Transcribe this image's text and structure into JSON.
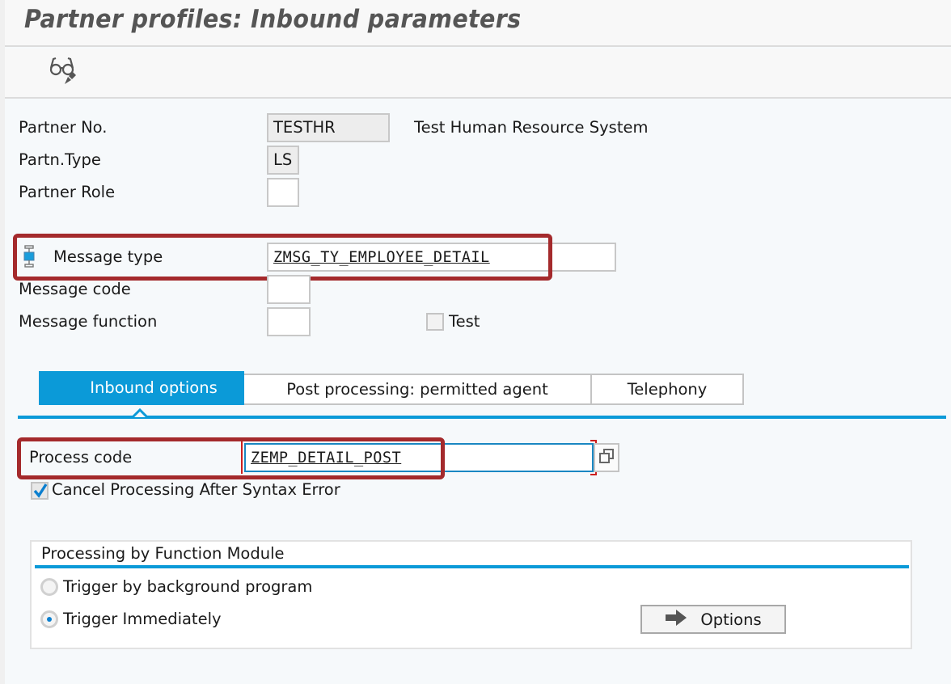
{
  "title": "Partner profiles: Inbound parameters",
  "toolbar": {
    "display_change_icon": "glasses-pencil-icon"
  },
  "header_fields": {
    "partner_no": {
      "label": "Partner No.",
      "value": "TESTHR",
      "description": "Test Human Resource System"
    },
    "partner_type": {
      "label": "Partn.Type",
      "value": "LS"
    },
    "partner_role": {
      "label": "Partner Role",
      "value": ""
    },
    "message_type": {
      "label": "Message type",
      "value": "ZMSG_TY_EMPLOYEE_DETAIL",
      "icon": "hierarchy-node-icon"
    },
    "message_code": {
      "label": "Message code",
      "value": ""
    },
    "message_function": {
      "label": "Message function",
      "value": ""
    },
    "test": {
      "label": "Test",
      "checked": false
    }
  },
  "tabs": [
    {
      "label": "Inbound options",
      "active": true
    },
    {
      "label": "Post processing: permitted agent",
      "active": false
    },
    {
      "label": "Telephony",
      "active": false
    }
  ],
  "inbound_options": {
    "process_code": {
      "label": "Process code",
      "value": "ZEMP_DETAIL_POST",
      "value_help_icon": "value-help-icon"
    },
    "cancel_processing": {
      "label": "Cancel Processing After Syntax Error",
      "checked": true
    },
    "function_module_group": {
      "title": "Processing by Function Module",
      "options": [
        {
          "label": "Trigger by background program",
          "selected": false
        },
        {
          "label": "Trigger Immediately",
          "selected": true
        }
      ],
      "options_button": {
        "label": "Options",
        "icon": "arrow-right-icon"
      }
    }
  },
  "colors": {
    "accent": "#0b9ad8",
    "highlight_box": "#a42a2c"
  }
}
